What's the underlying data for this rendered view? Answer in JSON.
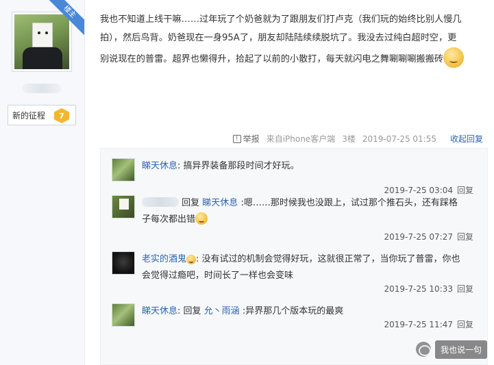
{
  "poster": {
    "badge": "楼主",
    "level_title": "新的征程",
    "level_number": "7"
  },
  "post": {
    "lines": [
      "我也不知道上线干嘛……过年玩了个奶爸就为了跟朋友们打卢克（我们玩的始终比别人慢几",
      "拍），然后鸟背。奶爸现在一身95A了，朋友却陆陆续续脱坑了。我没去过纯白超时空，更",
      "别说现在的普雷。超界也懒得升，拾起了以前的小散打，每天就闪电之舞唰唰唰搬搬砖"
    ]
  },
  "post_meta": {
    "report": "举报",
    "client": "来自iPhone客户端",
    "floor": "3楼",
    "time": "2019-07-25 01:55",
    "collapse": "收起回复"
  },
  "replies": [
    {
      "name": "睇天休息",
      "text": ": 搞异界装备那段时间才好玩。",
      "time": "2019-7-25 03:04",
      "reply": "回复"
    },
    {
      "reply_word": "回复",
      "target": "睇天休息",
      "line1": " :嗯……那时候我也没跟上，试过那个推石头，还有踩格",
      "line2": "子每次都出错",
      "time": "2019-7-25 07:27",
      "reply": "回复"
    },
    {
      "name": "老实的酒鬼",
      "line1": ": 没有试过的机制会觉得好玩，这就很正常了，当你玩了普雷，你也",
      "line2": "会觉得过瘾吧，时间长了一样也会变味",
      "time": "2019-7-25 10:33",
      "reply": "回复"
    },
    {
      "name": "睇天休息",
      "mid": ": 回复 ",
      "target": "允丶雨涵",
      "text": " :异界那几个版本玩的最爽",
      "time": "2019-7-25 11:47",
      "reply": "回复"
    }
  ],
  "watermark": {
    "text": "我也说一句"
  }
}
